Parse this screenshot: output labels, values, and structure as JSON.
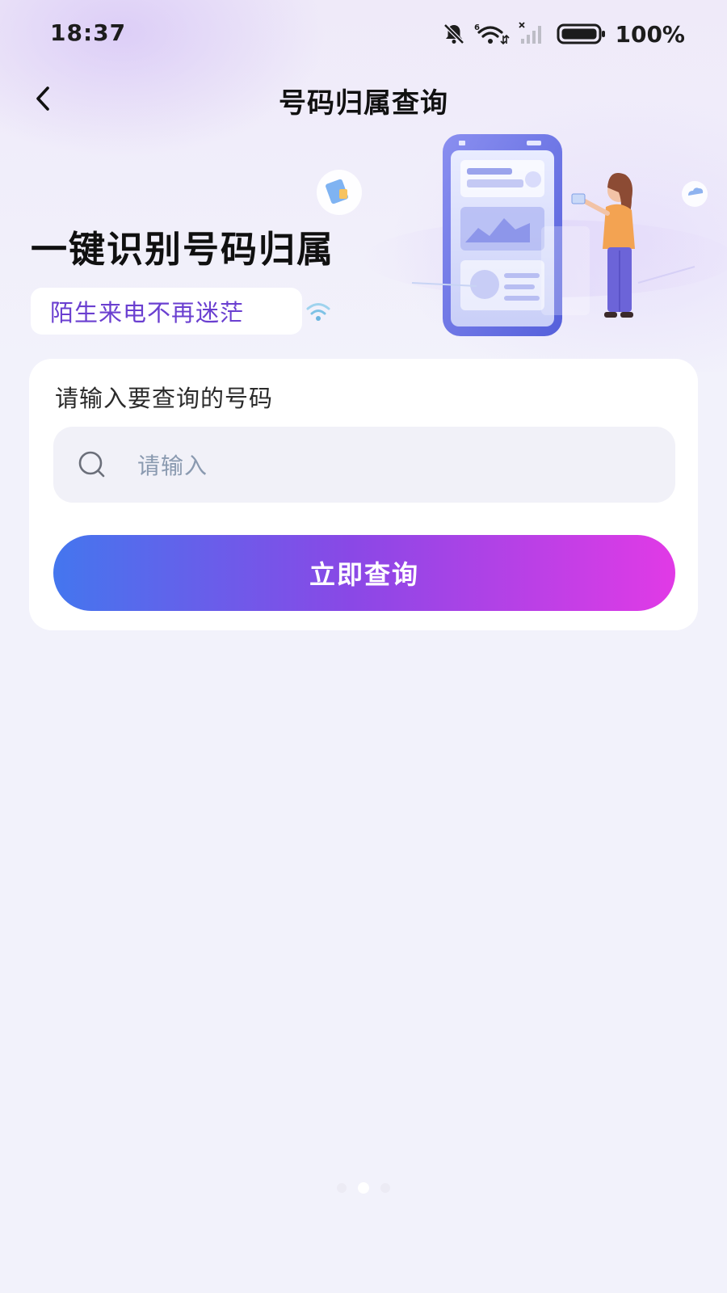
{
  "status_bar": {
    "time": "18:37",
    "battery": "100%",
    "icons": [
      "mute-bell-icon",
      "wifi-icon",
      "signal-icon",
      "battery-icon"
    ]
  },
  "nav": {
    "back_icon": "chevron-left-icon",
    "title": "号码归属查询"
  },
  "hero": {
    "title": "一键识别号码归属",
    "subtitle": "陌生来电不再迷茫"
  },
  "card": {
    "label": "请输入要查询的号码",
    "search": {
      "placeholder": "请输入",
      "value": "",
      "icon": "search-icon"
    },
    "button_label": "立即查询"
  },
  "colors": {
    "accent_text": "#6a3fd0",
    "button_gradient_start": "#4476ee",
    "button_gradient_mid": "#8a48e6",
    "button_gradient_end": "#e13ae6",
    "background": "#f2f2fb"
  }
}
